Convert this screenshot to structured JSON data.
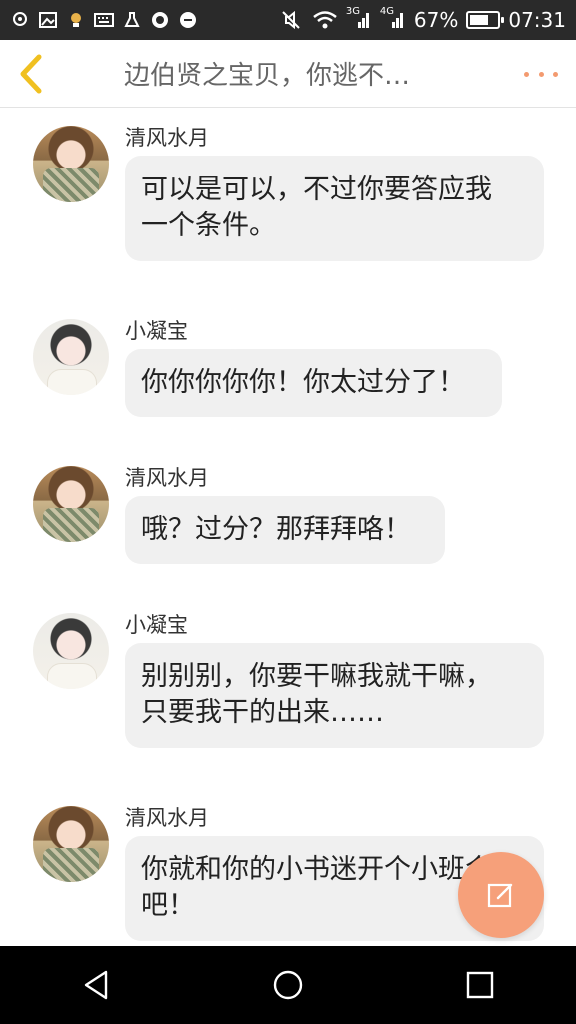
{
  "status_bar": {
    "net_3g": "3G",
    "net_4g": "4G",
    "battery_percent": "67%",
    "battery_level": 0.67,
    "time": "07:31"
  },
  "header": {
    "title": "边伯贤之宝贝，你逃不…",
    "back_icon": "chevron-left-icon",
    "more_icon": "more-dots-icon"
  },
  "messages": [
    {
      "sender": "清风水月",
      "avatar": "qfsy",
      "text": "可以是可以，不过你要答应我\n一个条件。"
    },
    {
      "sender": "小凝宝",
      "avatar": "xnb",
      "text": "你你你你你！你太过分了！"
    },
    {
      "sender": "清风水月",
      "avatar": "qfsy",
      "text": "哦？过分？那拜拜咯！"
    },
    {
      "sender": "小凝宝",
      "avatar": "xnb",
      "text": "别别别，你要干嘛我就干嘛，\n只要我干的出来……"
    },
    {
      "sender": "清风水月",
      "avatar": "qfsy",
      "text": "你就和你的小书迷开个小班会\n吧！"
    }
  ],
  "fab": {
    "icon": "compose-icon"
  },
  "nav_bar": {
    "back_icon": "triangle-back-icon",
    "home_icon": "circle-home-icon",
    "recents_icon": "square-recents-icon"
  },
  "colors": {
    "accent": "#f39a6f",
    "back_arrow": "#f0c020",
    "bubble": "#f0f0f0",
    "status_bar": "#2a2a2a",
    "nav_bar": "#000000"
  }
}
